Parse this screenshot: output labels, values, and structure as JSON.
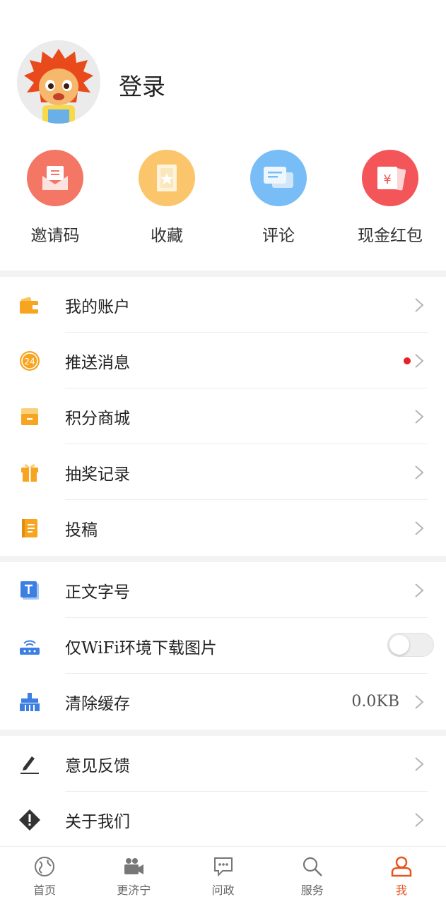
{
  "profile": {
    "login_label": "登录"
  },
  "quick_actions": [
    {
      "label": "邀请码",
      "color": "#f47766",
      "icon": "envelope-icon"
    },
    {
      "label": "收藏",
      "color": "#fbc66b",
      "icon": "bookmark-icon"
    },
    {
      "label": "评论",
      "color": "#78bdf5",
      "icon": "comment-icon"
    },
    {
      "label": "现金红包",
      "color": "#f35558",
      "icon": "red-packet-icon"
    }
  ],
  "menu_section1": [
    {
      "label": "我的账户",
      "icon": "wallet-icon"
    },
    {
      "label": "推送消息",
      "icon": "push-24-icon",
      "has_dot": true
    },
    {
      "label": "积分商城",
      "icon": "store-icon"
    },
    {
      "label": "抽奖记录",
      "icon": "gift-icon"
    },
    {
      "label": "投稿",
      "icon": "notebook-icon"
    }
  ],
  "menu_section2": [
    {
      "label": "正文字号",
      "icon": "font-size-icon"
    },
    {
      "label": "仅WiFi环境下载图片",
      "icon": "router-icon",
      "toggle": false
    },
    {
      "label": "清除缓存",
      "icon": "broom-icon",
      "value": "0.0KB"
    }
  ],
  "menu_section3": [
    {
      "label": "意见反馈",
      "icon": "edit-icon"
    },
    {
      "label": "关于我们",
      "icon": "info-diamond-icon"
    }
  ],
  "tabs": [
    {
      "label": "首页",
      "icon": "globe-icon"
    },
    {
      "label": "更济宁",
      "icon": "video-camera-icon"
    },
    {
      "label": "问政",
      "icon": "chat-icon"
    },
    {
      "label": "服务",
      "icon": "search-icon"
    },
    {
      "label": "我",
      "icon": "user-icon",
      "active": true
    }
  ],
  "colors": {
    "accent": "#e8541d",
    "icon_orange": "#f7a520",
    "icon_blue": "#3c7fe0"
  }
}
